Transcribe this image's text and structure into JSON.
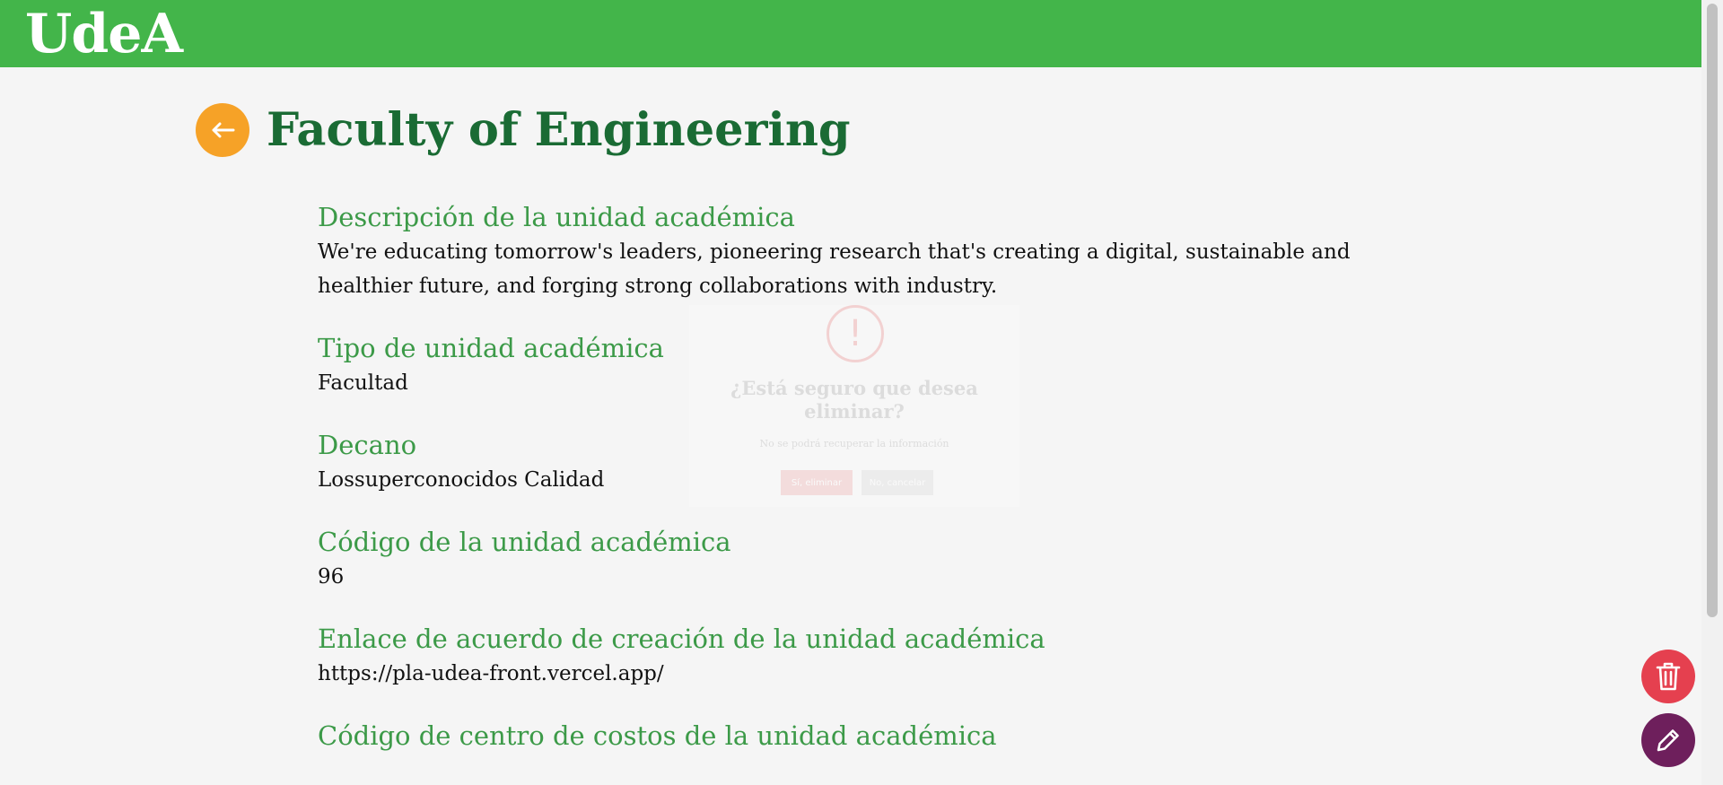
{
  "header": {
    "logo_text": "UdeA",
    "color": "#43b54a"
  },
  "page": {
    "title": "Faculty of Engineering",
    "back_icon": "arrow-left-icon"
  },
  "fields": [
    {
      "label": "Descripción de la unidad académica",
      "value": "We're educating tomorrow's leaders, pioneering research that's creating a digital, sustainable and healthier future, and forging strong collaborations with industry."
    },
    {
      "label": "Tipo de unidad académica",
      "value": "Facultad"
    },
    {
      "label": "Decano",
      "value": "Lossuperconocidos Calidad"
    },
    {
      "label": "Código de la unidad académica",
      "value": "96"
    },
    {
      "label": "Enlace de acuerdo de creación de la unidad académica",
      "value": "https://pla-udea-front.vercel.app/"
    },
    {
      "label": "Código de centro de costos de la unidad académica",
      "value": ""
    }
  ],
  "modal": {
    "icon": "!",
    "title": "¿Está seguro que desea eliminar?",
    "text": "No se podrá recuperar la información",
    "confirm_label": "Sí, eliminar",
    "cancel_label": "No, cancelar"
  },
  "actions": {
    "delete_icon": "trash-icon",
    "edit_icon": "pencil-icon"
  },
  "colors": {
    "accent": "#f6a227",
    "title": "#1a6b34",
    "label": "#3c9a48",
    "delete": "#e5404f",
    "edit": "#6e1f5c"
  }
}
